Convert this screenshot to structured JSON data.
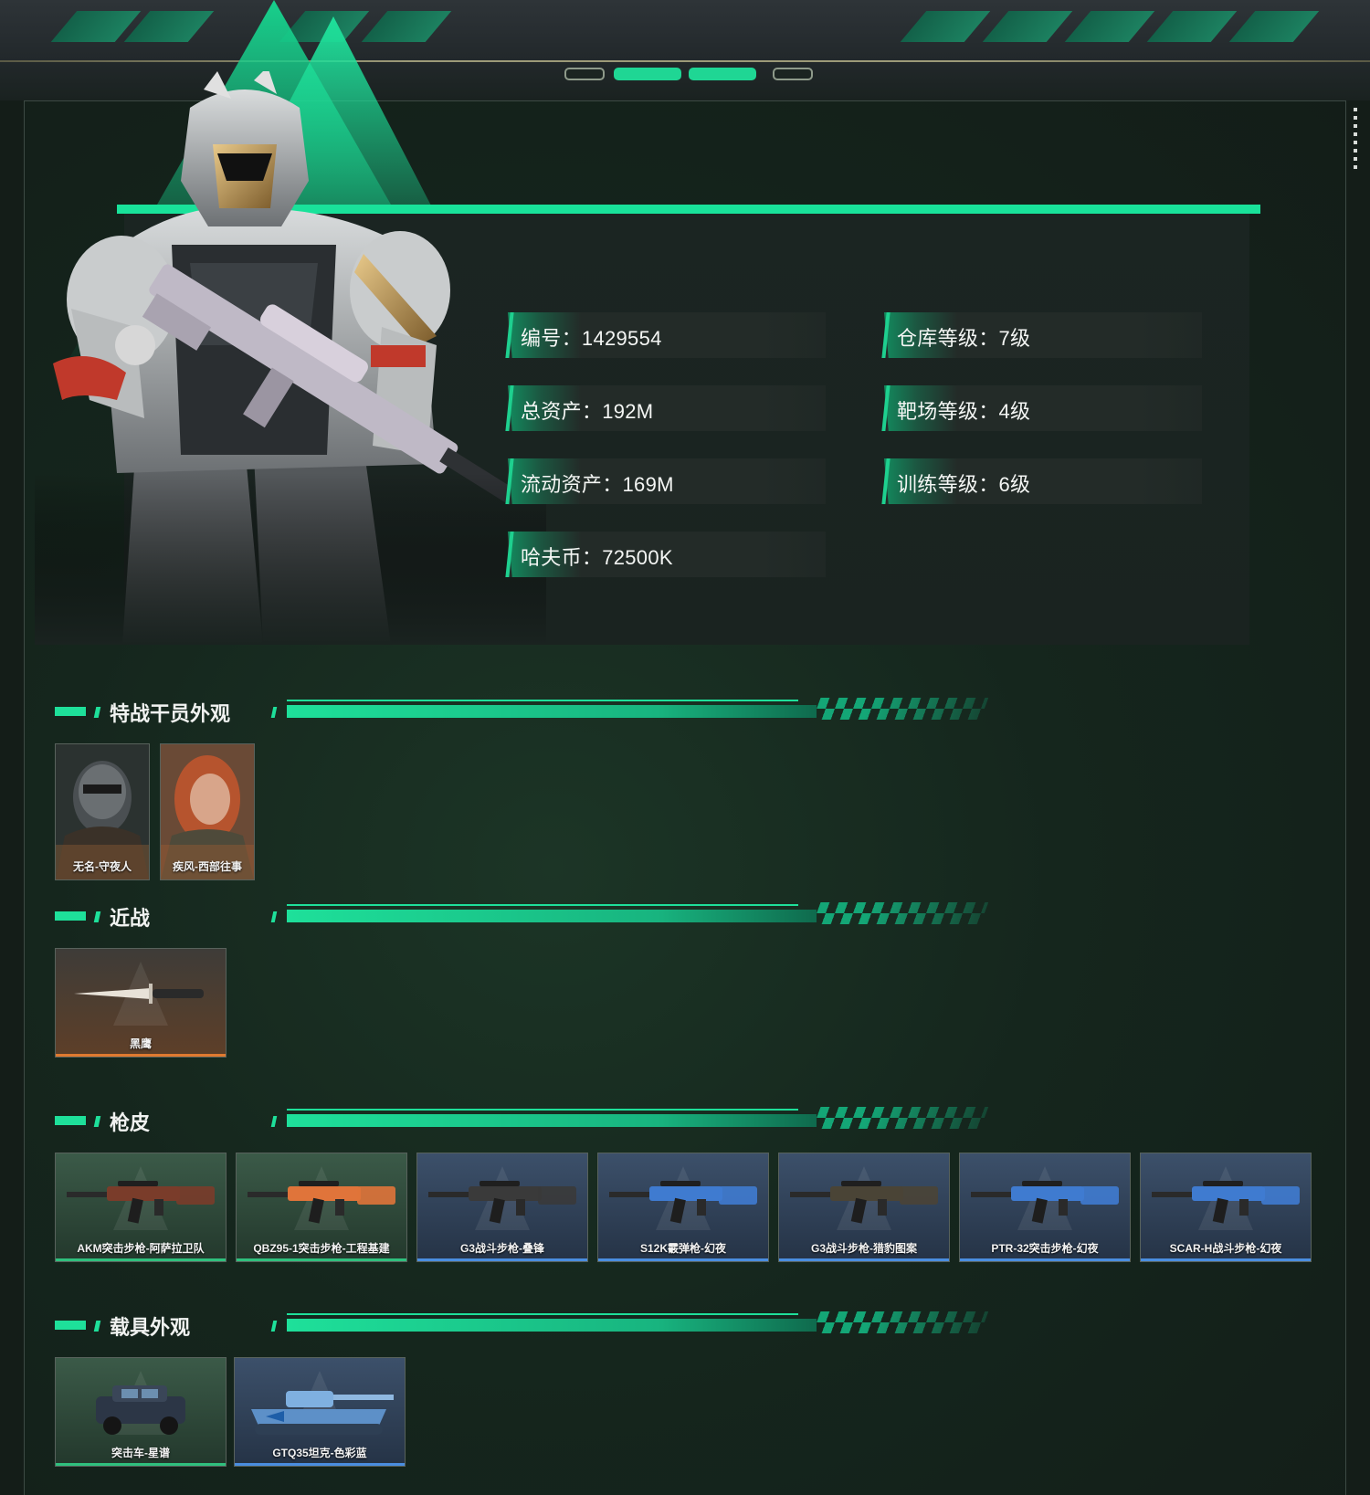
{
  "stats": [
    {
      "label": "编号：",
      "value": "1429554"
    },
    {
      "label": "总资产：",
      "value": "192M"
    },
    {
      "label": "流动资产：",
      "value": "169M"
    },
    {
      "label": "哈夫币：",
      "value": "72500K"
    },
    {
      "label": "仓库等级：",
      "value": "7级"
    },
    {
      "label": "靶场等级：",
      "value": "4级"
    },
    {
      "label": "训练等级：",
      "value": "6级"
    }
  ],
  "sections": {
    "operators": {
      "title": "特战干员外观",
      "items": [
        "无名-守夜人",
        "疾风-西部往事"
      ]
    },
    "melee": {
      "title": "近战",
      "items": [
        "黑鹰"
      ]
    },
    "gun_skins": {
      "title": "枪皮",
      "items": [
        {
          "name": "AKM突击步枪-阿萨拉卫队",
          "rarity": "green"
        },
        {
          "name": "QBZ95-1突击步枪-工程基建",
          "rarity": "green"
        },
        {
          "name": "G3战斗步枪-叠锋",
          "rarity": "blue"
        },
        {
          "name": "S12K霰弹枪-幻夜",
          "rarity": "blue"
        },
        {
          "name": "G3战斗步枪-猎豹图案",
          "rarity": "blue"
        },
        {
          "name": "PTR-32突击步枪-幻夜",
          "rarity": "blue"
        },
        {
          "name": "SCAR-H战斗步枪-幻夜",
          "rarity": "blue"
        }
      ]
    },
    "vehicles": {
      "title": "载具外观",
      "items": [
        {
          "name": "突击车-星谱",
          "rarity": "green"
        },
        {
          "name": "GTQ35坦克-色彩蓝",
          "rarity": "blue"
        }
      ]
    }
  },
  "colors": {
    "accent": "#1ee09a",
    "green_rarity": "#2fc07e",
    "blue_rarity": "#4a8ee0",
    "orange_rarity": "#e07a30"
  },
  "icons": [
    "operator-soldier-icon",
    "knife-icon",
    "rifle-icon",
    "vehicle-icon",
    "tank-icon"
  ]
}
